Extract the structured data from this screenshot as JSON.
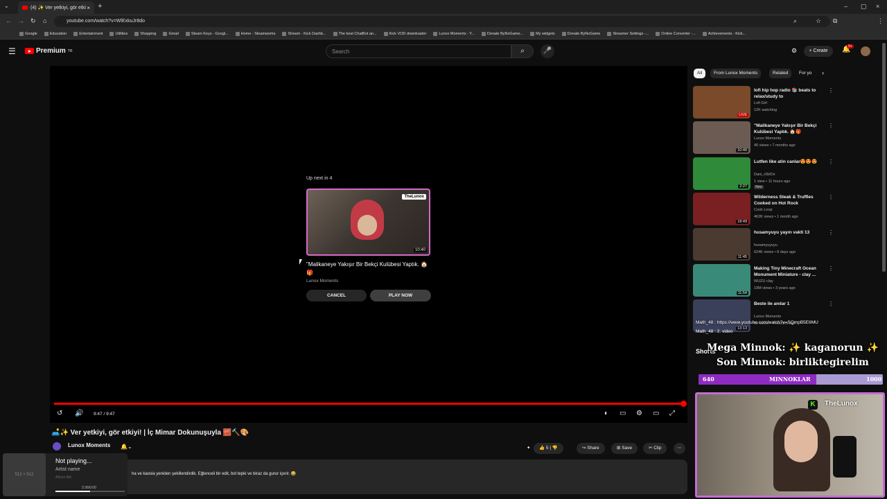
{
  "browser": {
    "tab_title": "(4) ✨ Ver yetkiyi, gör etkiyi! | İç Mimar ...",
    "url": "youtube.com/watch?v=WlExkuJr8do",
    "bookmarks": [
      "Google",
      "Education",
      "Entertainment",
      "Utilities",
      "Shopping",
      "Gmail",
      "Steam Keys - Googl...",
      "Home - Steamworks",
      "Stream - Kick Dashb...",
      "The best ChatBot an...",
      "Kick VOD downloader",
      "Lunox Moments - Y...",
      "Donate ByNoGame...",
      "My widgets",
      "Donate ByNoGame",
      "Streamer Settings -...",
      "Online Converter -...",
      "Achievements - Kick..."
    ]
  },
  "header": {
    "logo": "Premium",
    "logo_sup": "TR",
    "search_placeholder": "Search",
    "create": "Create",
    "notif_count": "9+"
  },
  "player": {
    "upnext_label": "Up next in 4",
    "upnext_title": "\"Malikaneye Yakışır Bir Bekçi Kulübesi Yaptık. 🏠🎁",
    "upnext_channel": "Lunox Moments",
    "upnext_brand": "TheLunox",
    "upnext_duration": "10:40",
    "cancel": "CANCEL",
    "play_now": "PLAY NOW",
    "time": "9:47 / 9:47",
    "progress": 1.0
  },
  "video": {
    "title": "🛋️✨ Ver yetkiyi, gör etkiyi! | İç Mimar Dokunuşuyla 🧱🔨🎨",
    "channel": "Lunox Moments",
    "likes": "5",
    "share": "Share",
    "save": "Save",
    "clip": "Clip",
    "description": "ha ve kaosla yeniden şekillendirdik. Eğlenceli bir edit, bol tepki ve biraz da gurur içerir. 😂"
  },
  "mini_player": {
    "art": "512 × 512",
    "title": "Not playing...",
    "artist": "Artist name",
    "album": "Album title",
    "time": "2:36/0:00",
    "progress": 0.5
  },
  "chips": [
    "All",
    "From Lunox Moments",
    "Related",
    "For yo"
  ],
  "related": [
    {
      "title": "lofi hip hop radio 📚 beats to relax/study to",
      "channel": "Lofi Girl",
      "meta": "12K watching",
      "badge": "LIVE",
      "color": "#7a4a2a"
    },
    {
      "title": "\"Malikaneye Yakışır Bir Bekçi Kulübesi Yaptık. 🏠🎁",
      "channel": "Lunox Moments",
      "meta": "40 views • 7 months ago",
      "duration": "10:40",
      "color": "#6b5b52"
    },
    {
      "title": "Lutfen like atin canlar😍😍😍",
      "channel": "Dani_r0blOx",
      "meta": "1 view • 11 hours ago",
      "badge": "New",
      "duration": "2:27",
      "color": "#2f8a3a"
    },
    {
      "title": "Wilderness Steak & Truffles Cooked on Hot Rock",
      "channel": "Cook Loop",
      "meta": "462K views • 1 month ago",
      "duration": "18:49",
      "color": "#7a1f22"
    },
    {
      "title": "husamyuyu yayın vakti 13",
      "channel": "husamyuyuyu",
      "meta": "624K views • 8 days ago",
      "duration": "11:45",
      "color": "#4a3a30"
    },
    {
      "title": "Making Tiny Minecraft Ocean Monument Miniature - clay ...",
      "channel": "WUZU clay",
      "meta": "19M views • 3 years ago",
      "duration": "11:54",
      "color": "#3a8a7a"
    },
    {
      "title": "Beste ile anılar 1",
      "channel": "Lunox Moments",
      "meta": "10 views • 4 months ago",
      "duration": "13:13",
      "color": "#3a3f5a"
    }
  ],
  "stream_overlay": {
    "chat1": "Math_48 : https://www.youtube.com/watch?v=SQmpB5EtIMU",
    "chat2": "Math_48 : 2. video",
    "shorts": "Shorts",
    "goal_line1": "Mega Minnok: ✨ kaganorun ✨",
    "goal_line2": "Son Minnok: birliktegirelim",
    "goal_current": "640",
    "goal_label": "MINNOKLAR",
    "goal_max": "1000",
    "goal_fraction": 0.64,
    "cam_brand": "TheLunox"
  },
  "colors": {
    "accent": "#ff0000",
    "kick_green": "#53fc18",
    "overlay_border": "#c36dd1"
  }
}
